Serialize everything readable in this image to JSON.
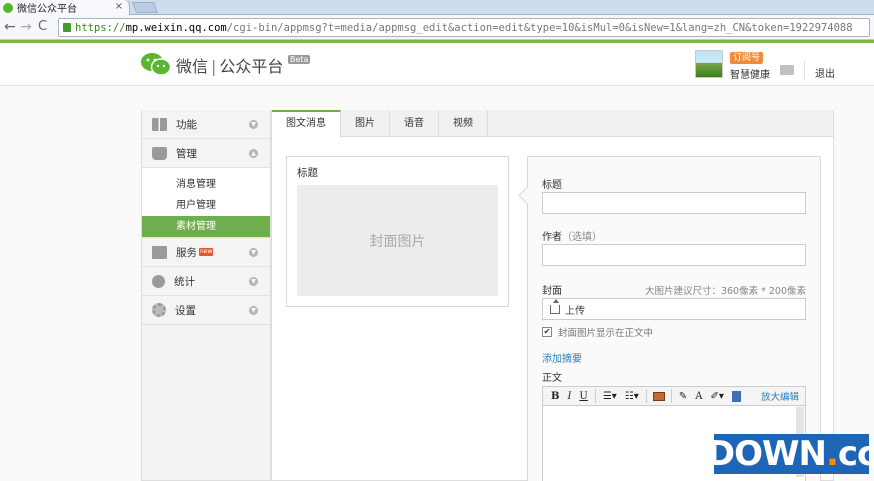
{
  "browser": {
    "tab_title": "微信公众平台",
    "tab_close": "×",
    "url_scheme": "https://",
    "url_host": "mp.weixin.qq.com",
    "url_path": "/cgi-bin/appmsg?t=media/appmsg_edit&action=edit&type=10&isMul=0&isNew=1&lang=zh_CN&token=1922974088",
    "back": "←",
    "forward": "→",
    "reload": "C"
  },
  "header": {
    "logo": "微信",
    "sep": "|",
    "platform": "公众平台",
    "beta": "Beta",
    "account_type": "订阅号",
    "account_name": "智慧健康",
    "logout": "退出"
  },
  "sidebar": {
    "items": [
      {
        "label": "功能",
        "icon": "grid-icon"
      },
      {
        "label": "管理",
        "icon": "tray-icon"
      },
      {
        "label": "服务",
        "icon": "printer-icon",
        "badge": "new"
      },
      {
        "label": "统计",
        "icon": "pie-icon"
      },
      {
        "label": "设置",
        "icon": "gear-icon"
      }
    ],
    "sub_items": [
      {
        "label": "消息管理"
      },
      {
        "label": "用户管理"
      },
      {
        "label": "素材管理",
        "active": true
      }
    ]
  },
  "tabs": [
    {
      "label": "图文消息",
      "active": true
    },
    {
      "label": "图片"
    },
    {
      "label": "语音"
    },
    {
      "label": "视频"
    }
  ],
  "preview": {
    "title": "标题",
    "cover": "封面图片"
  },
  "form": {
    "title_label": "标题",
    "author_label": "作者",
    "author_hint": "（选填）",
    "cover_label": "封面",
    "cover_size_hint": "大图片建议尺寸：360像素 * 200像素",
    "upload": "上传",
    "show_cover": "封面图片显示在正文中",
    "show_cover_checked": true,
    "add_summary": "添加摘要",
    "body_label": "正文",
    "expand_editor": "放大编辑"
  },
  "toolbar": {
    "bold": "B",
    "italic": "I",
    "underline": "U",
    "font_color": "A"
  },
  "watermark": {
    "text": "DOWN",
    "dot": ".",
    "tld": "cc"
  },
  "colors": {
    "accent": "#6fae4d",
    "link": "#2d7db8",
    "badge": "#f38a3a"
  }
}
